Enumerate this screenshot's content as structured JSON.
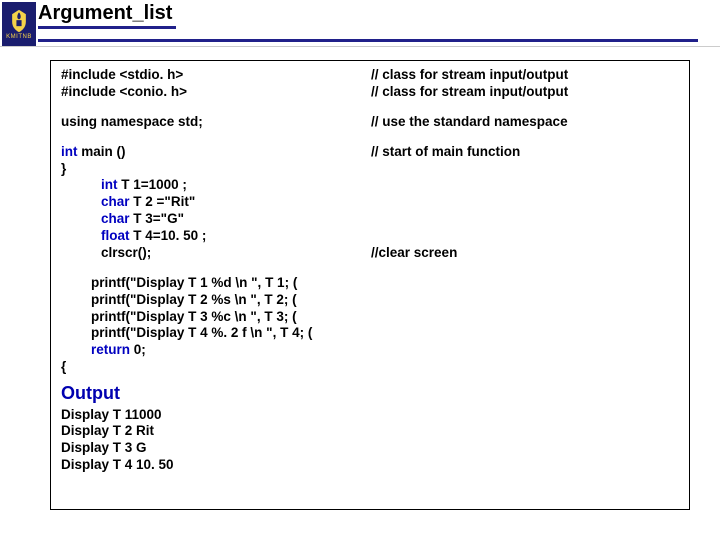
{
  "header": {
    "logo_label": "KMITNB",
    "title": "Argument_list"
  },
  "code": {
    "include1_left": "#include <stdio. h>",
    "include1_right": "// class for stream input/output",
    "include2_left": "#include <conio. h>",
    "include2_right": "// class for stream input/output",
    "using_left": "using namespace std;",
    "using_right": "// use the standard namespace",
    "main_kw": "int",
    "main_rest": " main ()",
    "main_right": "// start of main function",
    "brace_open": "}",
    "decl_int_kw": "int",
    "decl_int_rest": "   T 1=1000 ;",
    "decl_char1_kw": "char",
    "decl_char1_rest": " T 2 =\"Rit\"",
    "decl_char2_kw": "char",
    "decl_char2_rest": " T 3=\"G\"",
    "decl_float_kw": "float",
    "decl_float_rest": " T 4=10. 50   ;",
    "clrscr_left": "clrscr();",
    "clrscr_right": "//clear screen",
    "p1": "printf(\"Display T 1 %d \\n \", T 1; (",
    "p2": "printf(\"Display T 2 %s \\n \", T 2; (",
    "p3": "printf(\"Display T 3 %c \\n \", T 3; (",
    "p4": "printf(\"Display T 4 %. 2 f \\n \", T 4; (",
    "ret_kw": "return",
    "ret_rest": " 0;",
    "brace_close": "{"
  },
  "output": {
    "heading": "Output",
    "l1": "Display T 11000",
    "l2": "Display T 2 Rit",
    "l3": "Display T 3  G",
    "l4": "Display T 4 10. 50"
  }
}
